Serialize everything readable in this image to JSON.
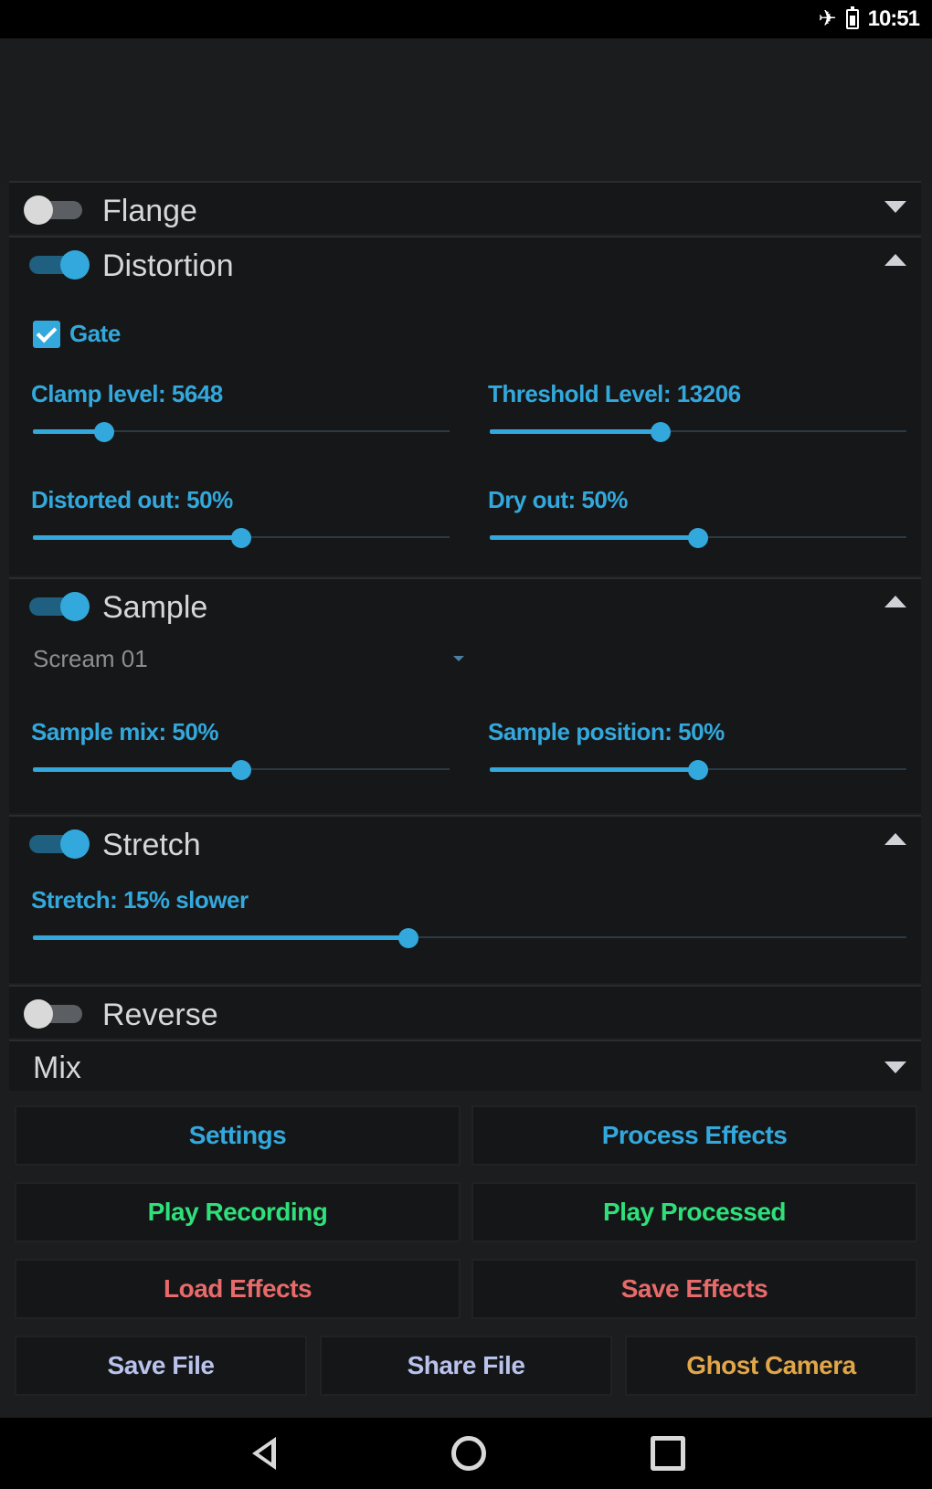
{
  "status_bar": {
    "time": "10:51"
  },
  "effects": {
    "flange": {
      "title": "Flange",
      "enabled": false
    },
    "distortion": {
      "title": "Distortion",
      "enabled": true,
      "gate_label": "Gate",
      "gate_checked": true,
      "clamp_label": "Clamp level: 5648",
      "clamp_value": 0.17,
      "threshold_label": "Threshold Level: 13206",
      "threshold_value": 0.41,
      "distorted_label": "Distorted out: 50%",
      "distorted_value": 0.5,
      "dry_label": "Dry out: 50%",
      "dry_value": 0.5
    },
    "sample": {
      "title": "Sample",
      "enabled": true,
      "selected_sample": "Scream 01",
      "mix_label": "Sample mix: 50%",
      "mix_value": 0.5,
      "position_label": "Sample position: 50%",
      "position_value": 0.5
    },
    "stretch": {
      "title": "Stretch",
      "enabled": true,
      "stretch_label": "Stretch: 15% slower",
      "stretch_value": 0.43
    },
    "reverse": {
      "title": "Reverse",
      "enabled": false
    }
  },
  "mix": {
    "label": "Mix"
  },
  "buttons": {
    "settings": "Settings",
    "process_effects": "Process Effects",
    "play_recording": "Play Recording",
    "play_processed": "Play Processed",
    "load_effects": "Load Effects",
    "save_effects": "Save Effects",
    "save_file": "Save File",
    "share_file": "Share File",
    "ghost_camera": "Ghost Camera"
  },
  "colors": {
    "accent_blue": "#33a8dc",
    "green": "#2fe07a",
    "red": "#e86a6a",
    "lavender": "#b9c2ec",
    "orange": "#e2a64a"
  }
}
